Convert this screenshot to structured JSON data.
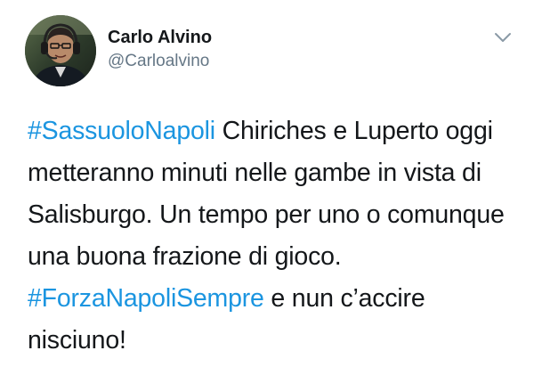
{
  "author": {
    "name": "Carlo Alvino",
    "handle": "@Carloalvino"
  },
  "icons": {
    "menu": "chevron-down-icon",
    "avatar": "avatar-photo"
  },
  "colors": {
    "hashtag": "#1b95e0",
    "text": "#14171a",
    "secondary": "#657786"
  },
  "tweet": {
    "hashtag_1": "#SassuoloNapoli",
    "text_1": " Chiriches e Luperto oggi metteranno minuti nelle gambe in vista di Salisburgo. Un tempo per uno o comunque una buona frazione di gioco. ",
    "hashtag_2": "#ForzaNapoliSempre",
    "text_2": " e nun c’accire nisciuno!"
  }
}
